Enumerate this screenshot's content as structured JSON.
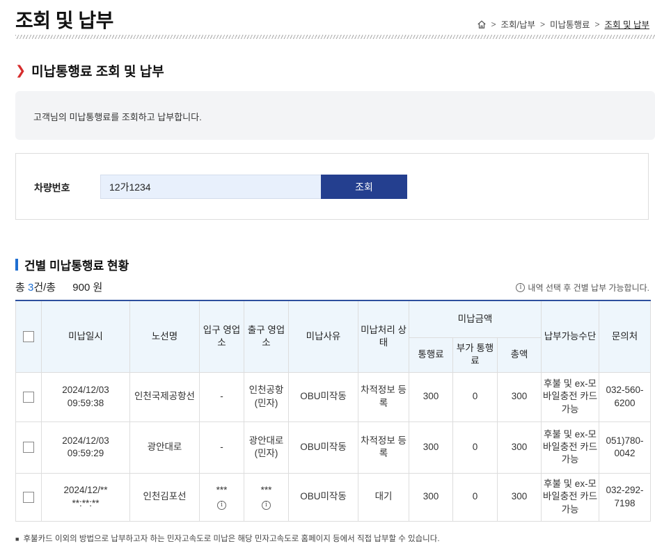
{
  "header": {
    "title": "조회 및 납부",
    "breadcrumb": {
      "home_icon": "home-icon",
      "items": [
        "조회/납부",
        "미납통행료",
        "조회 및 납부"
      ]
    }
  },
  "section": {
    "title": "미납통행료 조회 및 납부",
    "info_text": "고객님의 미납통행료를 조회하고 납부합니다."
  },
  "search": {
    "label": "차량번호",
    "value": "12가1234",
    "button": "조회"
  },
  "list": {
    "title": "건별 미납통행료 현황",
    "summary_prefix": "총",
    "count": "3",
    "summary_unit": "건/총",
    "amount": "900",
    "amount_unit": "원",
    "hint": "내역 선택 후 건별 납부 가능합니다."
  },
  "table": {
    "headers": {
      "date": "미납일시",
      "route": "노선명",
      "entry": "입구 영업소",
      "exit": "출구 영업소",
      "reason": "미납사유",
      "status": "미납처리 상태",
      "amount_group": "미납금액",
      "toll": "통행료",
      "surcharge": "부가 통행료",
      "total": "총액",
      "payment": "납부가능수단",
      "contact": "문의처"
    },
    "rows": [
      {
        "date": "2024/12/03",
        "time": "09:59:38",
        "route": "인천국제공항선",
        "entry": "-",
        "exit": "인천공항 (민자)",
        "reason": "OBU미작동",
        "status": "차적정보 등록",
        "toll": "300",
        "surcharge": "0",
        "total": "300",
        "payment": "후불 및 ex-모바일충전 카드 가능",
        "contact": "032-560-6200"
      },
      {
        "date": "2024/12/03",
        "time": "09:59:29",
        "route": "광안대로",
        "entry": "-",
        "exit": "광안대로 (민자)",
        "reason": "OBU미작동",
        "status": "차적정보 등록",
        "toll": "300",
        "surcharge": "0",
        "total": "300",
        "payment": "후불 및 ex-모바일충전 카드 가능",
        "contact": "051)780-0042"
      },
      {
        "date": "2024/12/**",
        "time": "**:**:**",
        "route": "인천김포선",
        "entry": "***",
        "exit": "***",
        "reason": "OBU미작동",
        "status": "대기",
        "toll": "300",
        "surcharge": "0",
        "total": "300",
        "payment": "후불 및 ex-모바일충전 카드 가능",
        "contact": "032-292-7198"
      }
    ]
  },
  "footnote": "후불카드 이외의 방법으로 납부하고자 하는 민자고속도로 미납은 해당 민자고속도로 홈페이지 등에서 직접 납부할 수 있습니다."
}
